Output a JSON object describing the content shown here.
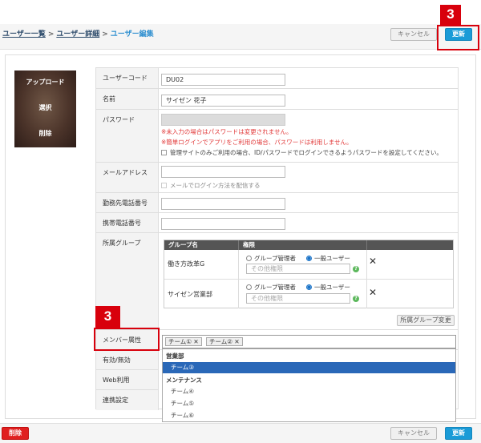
{
  "breadcrumb": {
    "users_list": "ユーザー一覧",
    "user_detail": "ユーザー詳細",
    "current": "ユーザー編集",
    "separator": ">"
  },
  "header": {
    "cancel_label": "キャンセル",
    "update_label": "更新"
  },
  "annotations": {
    "top_number": "3",
    "mid_number": "3"
  },
  "photo": {
    "upload_label": "アップロード",
    "select_label": "選択",
    "delete_label": "削除"
  },
  "form": {
    "user_code": {
      "label": "ユーザーコード",
      "value": "DU02"
    },
    "name": {
      "label": "名前",
      "value": "サイゼン 花子"
    },
    "password": {
      "label": "パスワード",
      "note1": "※未入力の場合はパスワードは変更されません。",
      "note2": "※簡単ログインでアプリをご利用の場合、パスワードは利用しません。",
      "checkbox_label": "管理サイトのみご利用の場合、ID/パスワードでログインできるようパスワードを設定してください。"
    },
    "email": {
      "label": "メールアドレス",
      "value": "",
      "checkbox_label": "メールでログイン方法を配信する"
    },
    "work_phone": {
      "label": "勤務先電話番号",
      "value": ""
    },
    "mobile_phone": {
      "label": "携帯電話番号",
      "value": ""
    },
    "groups": {
      "label": "所属グループ",
      "col_group": "グループ名",
      "col_role": "権限",
      "rows": [
        {
          "name": "働き方改革G",
          "opt_admin": "グループ管理者",
          "opt_general": "一般ユーザー",
          "selected": "general",
          "other_placeholder": "その他権限"
        },
        {
          "name": "サイゼン営業部",
          "opt_admin": "グループ管理者",
          "opt_general": "一般ユーザー",
          "selected": "general",
          "other_placeholder": "その他権限"
        }
      ],
      "change_button": "所属グループ変更"
    },
    "member_attr": {
      "label": "メンバー属性",
      "tags": [
        "チーム①",
        "チーム②"
      ],
      "dropdown": {
        "group1": "営業部",
        "group1_options": [
          "チーム③"
        ],
        "group2": "メンテナンス",
        "group2_options": [
          "チーム④",
          "チーム⑤",
          "チーム⑥"
        ]
      }
    },
    "validity": {
      "label": "有効/無効"
    },
    "web_use": {
      "label": "Web利用"
    },
    "integration": {
      "label": "連携設定"
    }
  },
  "footer": {
    "delete_label": "削除",
    "cancel_label": "キャンセル",
    "update_label": "更新"
  },
  "colors": {
    "accent": "#1a9bd7",
    "danger": "#e02020",
    "annotation": "#d8000c",
    "selected_option": "#2a68b8"
  }
}
